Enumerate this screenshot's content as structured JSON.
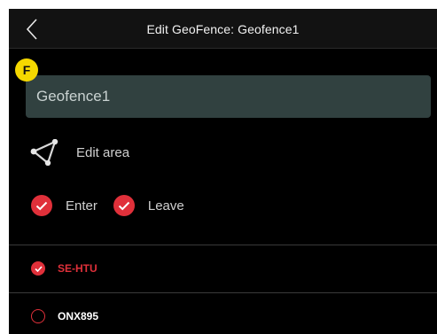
{
  "header": {
    "title": "Edit GeoFence: Geofence1"
  },
  "badge": {
    "label": "F"
  },
  "form": {
    "name_value": "Geofence1",
    "edit_area_label": "Edit area",
    "enter_label": "Enter",
    "leave_label": "Leave",
    "enter_checked": true,
    "leave_checked": true
  },
  "vehicles": [
    {
      "name": "SE-HTU",
      "selected": true
    },
    {
      "name": "ONX895",
      "selected": false
    }
  ],
  "colors": {
    "accent": "#e0303a",
    "badge": "#f5d800",
    "field_bg": "#314140",
    "header_bg": "#121212",
    "background": "#000000"
  },
  "icons": {
    "back": "chevron-left-icon",
    "edit_area": "polygon-area-icon",
    "checked": "check-circle-icon",
    "unchecked": "circle-outline-icon"
  }
}
